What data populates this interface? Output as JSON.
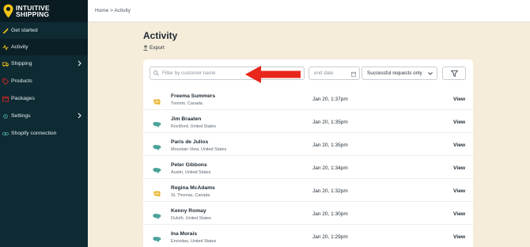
{
  "brand": {
    "line1": "INTUITIVE",
    "line2": "SHIPPING",
    "accent": "#f5c518"
  },
  "breadcrumb": "Home > Activity",
  "sidebar": {
    "items": [
      {
        "label": "Get started",
        "icon": "rocket-icon"
      },
      {
        "label": "Activity",
        "icon": "activity-icon",
        "active": true
      },
      {
        "label": "Shipping",
        "icon": "truck-icon",
        "has_submenu": true
      },
      {
        "label": "Products",
        "icon": "tag-icon"
      },
      {
        "label": "Packages",
        "icon": "package-icon"
      },
      {
        "label": "Settings",
        "icon": "gear-icon",
        "has_submenu": true
      },
      {
        "label": "Shopify connection",
        "icon": "link-icon"
      }
    ]
  },
  "page": {
    "title": "Activity",
    "export_label": "Export"
  },
  "filters": {
    "search_placeholder": "Filter by customer name",
    "start_date_placeholder": "",
    "end_date_placeholder": "end date",
    "status_selected": "Successful requests only"
  },
  "rows": [
    {
      "name": "Freema Summers",
      "location": "Toronto, Canada",
      "date": "Jan 20, 1:37pm",
      "action": "View",
      "flag": "canada"
    },
    {
      "name": "Jim Braaten",
      "location": "Rockford, United States",
      "date": "Jan 20, 1:35pm",
      "action": "View",
      "flag": "usa"
    },
    {
      "name": "Paris de Julios",
      "location": "Mountain View, United States",
      "date": "Jan 20, 1:35pm",
      "action": "View",
      "flag": "usa"
    },
    {
      "name": "Peter Gibbons",
      "location": "Austin, United States",
      "date": "Jan 20, 1:34pm",
      "action": "View",
      "flag": "usa"
    },
    {
      "name": "Regina McAdams",
      "location": "St. Thomas, Canada",
      "date": "Jan 20, 1:32pm",
      "action": "View",
      "flag": "canada"
    },
    {
      "name": "Kenny Romay",
      "location": "Duluth, United States",
      "date": "Jan 20, 1:30pm",
      "action": "View",
      "flag": "usa"
    },
    {
      "name": "Ina Morais",
      "location": "Encinitas, United States",
      "date": "Jan 20, 1:29pm",
      "action": "View",
      "flag": "usa"
    }
  ],
  "colors": {
    "sidebar": "#0e2a33",
    "background": "#f5ecd9",
    "arrow": "#e8261c",
    "canada_icon": "#e8b730",
    "usa_icon": "#4aa39a"
  }
}
